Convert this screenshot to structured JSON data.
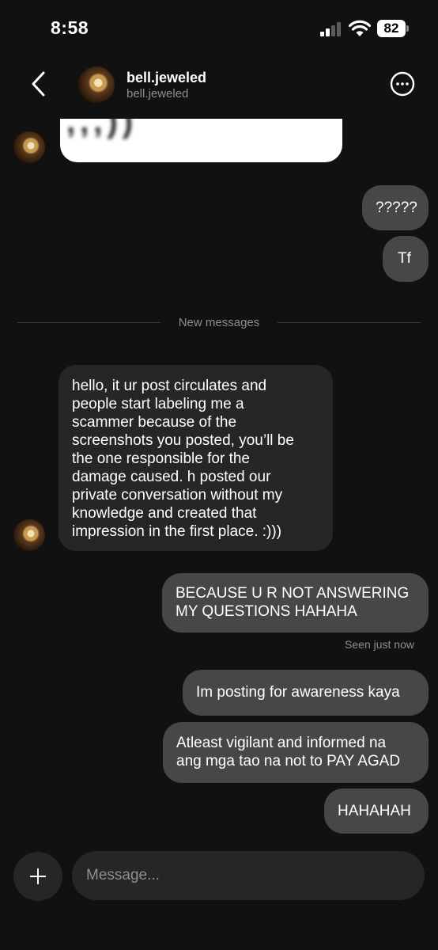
{
  "status_bar": {
    "time": "8:58",
    "battery": "82"
  },
  "header": {
    "name": "bell.jeweled",
    "username": "bell.jeweled"
  },
  "divider": {
    "label": "New messages"
  },
  "messages": {
    "m1": "?????",
    "m2": "Tf",
    "m3_lines": [
      "hello, it ur post circulates and",
      "people start labeling me a",
      "scammer because of the",
      "screenshots you posted, you’ll be",
      "the one responsible for the",
      "damage caused. h posted our",
      "private conversation without my",
      "knowledge and created that",
      "impression in the first place. :)))"
    ],
    "m4_lines": [
      "BECAUSE U R NOT ANSWERING",
      "MY QUESTIONS HAHAHA"
    ],
    "seen": "Seen just now",
    "m5": "Im posting for awareness kaya",
    "m6_lines": [
      "Atleast vigilant and informed na",
      "ang mga tao na not to PAY AGAD"
    ],
    "m7": "HAHAHAH"
  },
  "composer": {
    "placeholder": "Message..."
  }
}
